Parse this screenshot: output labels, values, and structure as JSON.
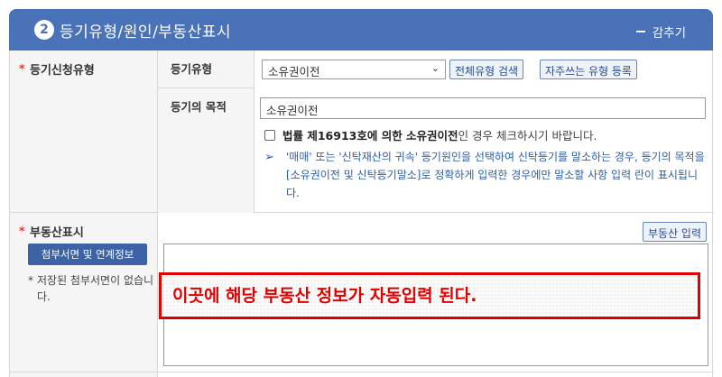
{
  "header": {
    "step_number": "2",
    "title": "등기유형/원인/부동산표시",
    "collapse_label": "감추기"
  },
  "registration_type": {
    "label": "등기신청유형",
    "type_label": "등기유형",
    "selected_type": "소유권이전",
    "search_all_button": "전체유형 검색",
    "register_favorite_button": "자주쓰는 유형 등록",
    "purpose_label": "등기의 목적",
    "purpose_value": "소유권이전",
    "checkbox_bold": "법률 제16913호에 의한 소유권이전",
    "checkbox_text": "인 경우 체크하시기 바랍니다.",
    "notice": "'매매' 또는 '신탁재산의 귀속' 등기원인을 선택하여 신탁등기를 말소하는 경우, 등기의 목적을 [소유권이전 및 신탁등기말소]로 정확하게 입력한 경우에만 말소할 사항 입력 란이 표시됩니다."
  },
  "real_estate": {
    "label": "부동산표시",
    "attach_button": "첨부서면 및 연계정보",
    "no_attach_bullet": "*",
    "no_attach_text": "저장된 첨부서면이 없습니다.",
    "input_button": "부동산 입력",
    "annotation": "이곳에 해당 부동산 정보가 자동입력 된다."
  },
  "colors": {
    "header_bg": "#4a72b8",
    "required": "#e53935",
    "annotation": "#e00000",
    "notice_text": "#2d5fa8"
  }
}
